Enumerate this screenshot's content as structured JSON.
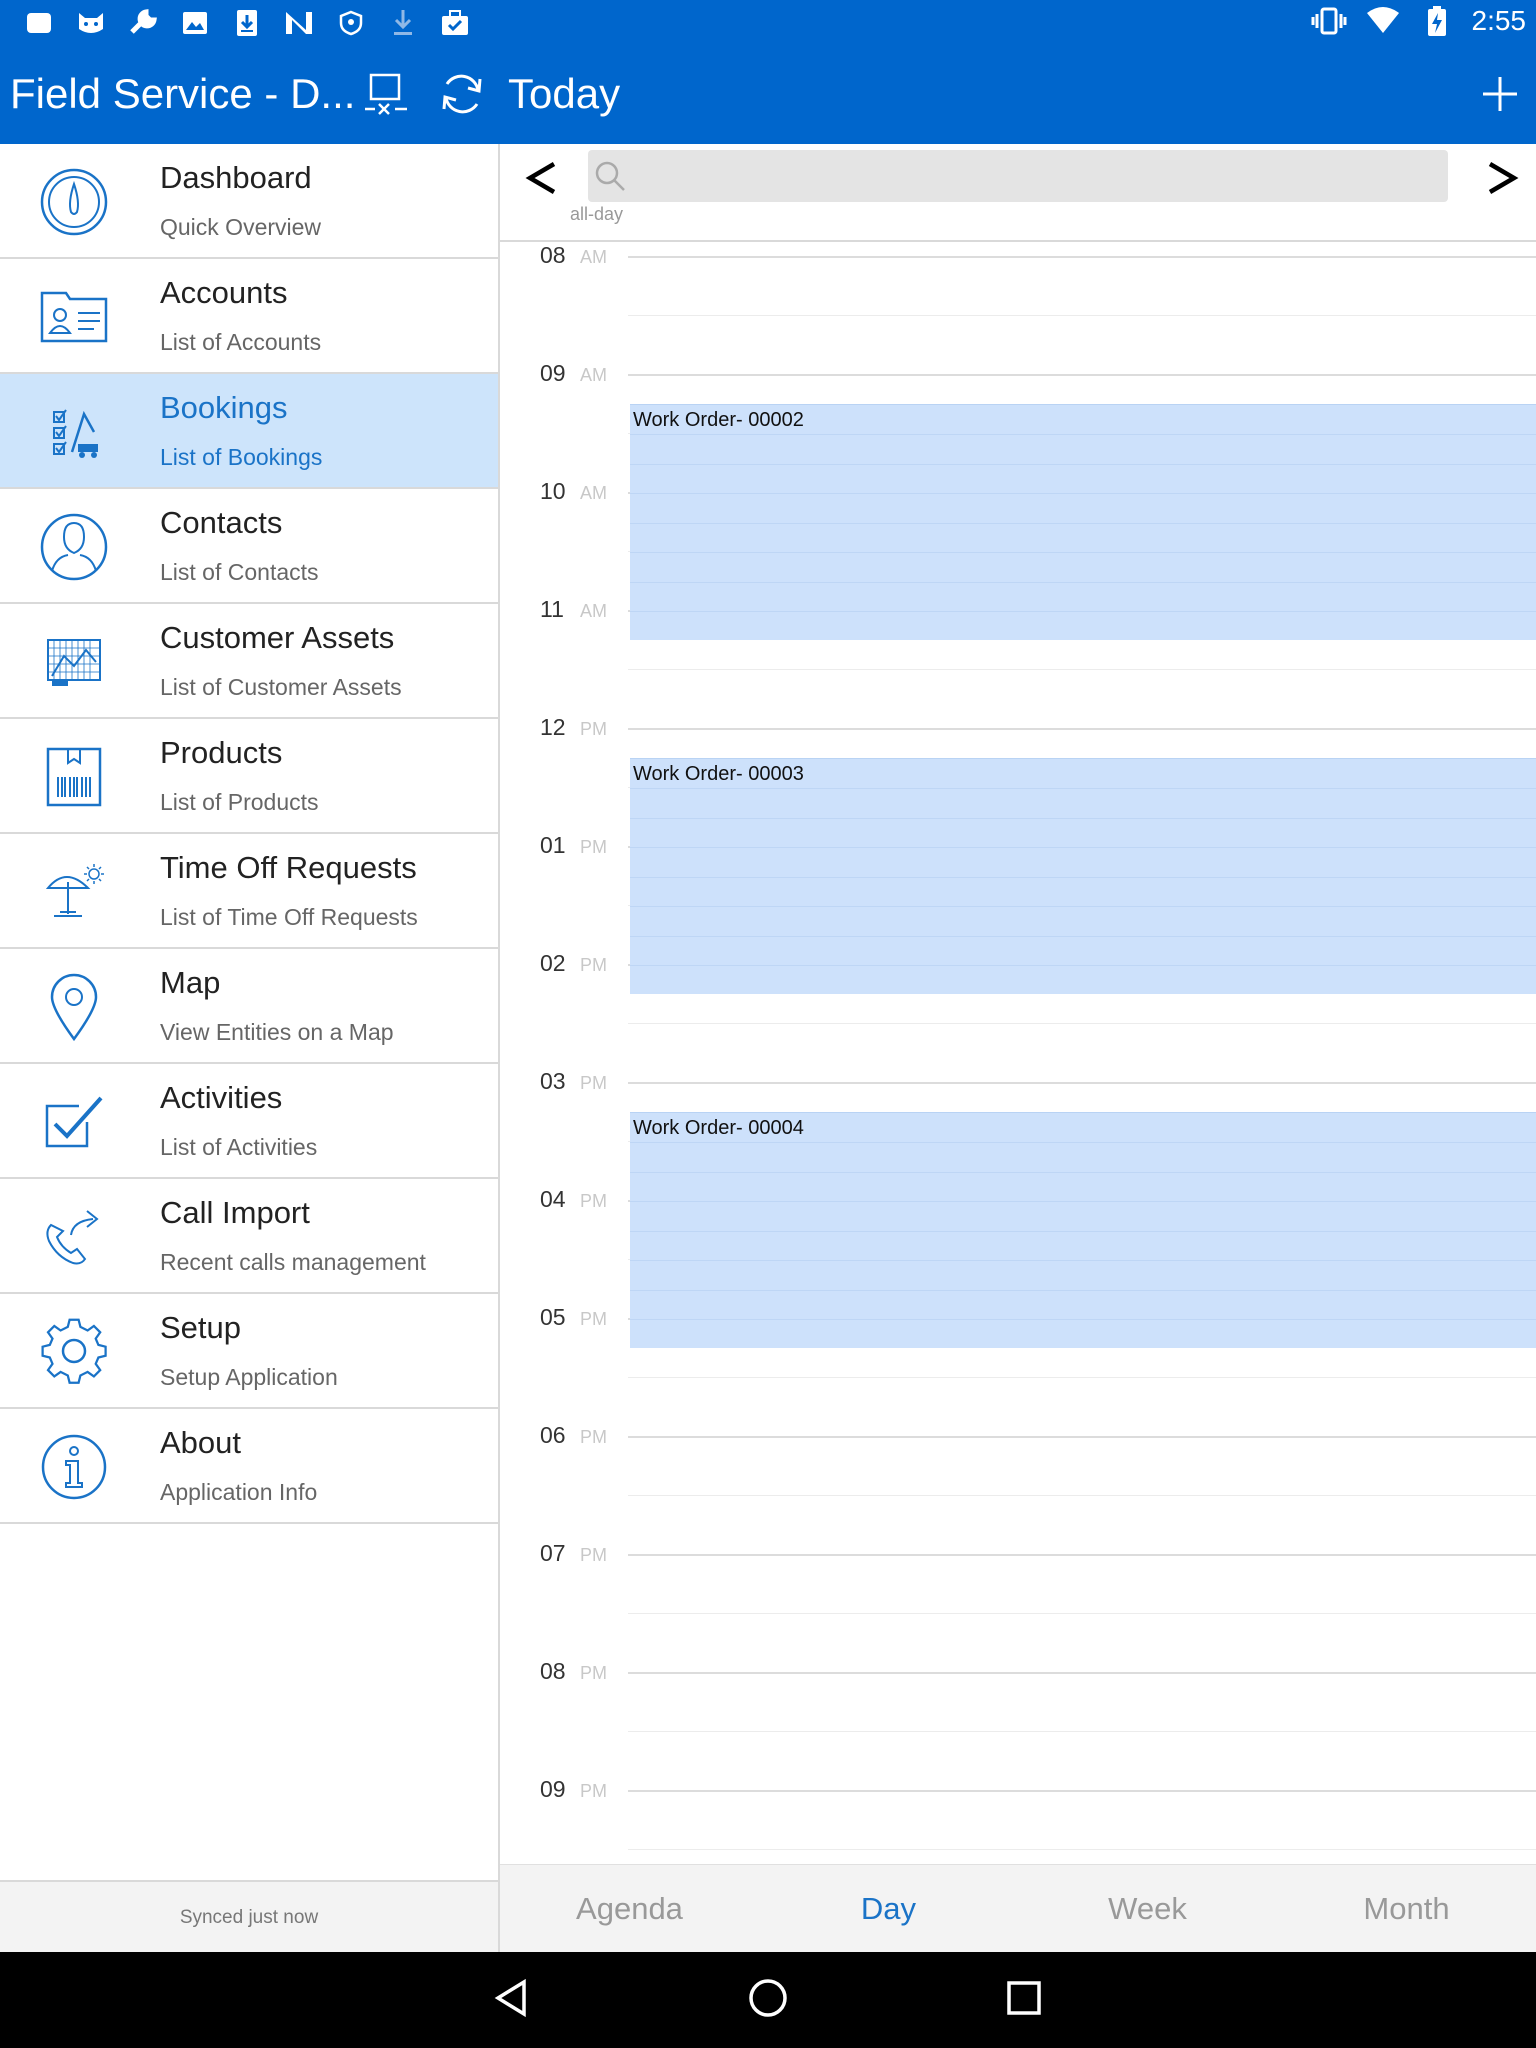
{
  "status_bar": {
    "time": "2:55",
    "left_icons": [
      "notification-icon",
      "cat-icon",
      "wrench-icon",
      "image-icon",
      "download-box-icon",
      "n-icon",
      "shield-icon",
      "download-icon",
      "briefcase-check-icon"
    ],
    "right_icons": [
      "vibrate-icon",
      "wifi-icon",
      "battery-icon"
    ]
  },
  "app_bar": {
    "title": "Field Service - D...",
    "today_label": "Today",
    "actions": [
      "disconnect-icon",
      "sync-icon",
      "add-icon"
    ]
  },
  "sidebar": {
    "items": [
      {
        "title": "Dashboard",
        "subtitle": "Quick Overview",
        "icon": "gauge-icon"
      },
      {
        "title": "Accounts",
        "subtitle": "List of Accounts",
        "icon": "contact-card-icon"
      },
      {
        "title": "Bookings",
        "subtitle": "List of Bookings",
        "icon": "checklist-crane-icon",
        "active": true
      },
      {
        "title": "Contacts",
        "subtitle": "List of Contacts",
        "icon": "person-icon"
      },
      {
        "title": "Customer Assets",
        "subtitle": "List of Customer Assets",
        "icon": "asset-icon"
      },
      {
        "title": "Products",
        "subtitle": "List of Products",
        "icon": "barcode-box-icon"
      },
      {
        "title": "Time Off Requests",
        "subtitle": "List of Time Off Requests",
        "icon": "beach-umbrella-icon"
      },
      {
        "title": "Map",
        "subtitle": "View Entities on a Map",
        "icon": "map-pin-icon"
      },
      {
        "title": "Activities",
        "subtitle": "List of Activities",
        "icon": "checkbox-icon"
      },
      {
        "title": "Call Import",
        "subtitle": "Recent calls management",
        "icon": "phone-forward-icon"
      },
      {
        "title": "Setup",
        "subtitle": "Setup Application",
        "icon": "gear-icon"
      },
      {
        "title": "About",
        "subtitle": "Application Info",
        "icon": "info-icon"
      }
    ],
    "sync_status": "Synced just now"
  },
  "calendar": {
    "all_day_label": "all-day",
    "hours": [
      {
        "hour": "08",
        "ampm": "AM"
      },
      {
        "hour": "09",
        "ampm": "AM"
      },
      {
        "hour": "10",
        "ampm": "AM"
      },
      {
        "hour": "11",
        "ampm": "AM"
      },
      {
        "hour": "12",
        "ampm": "PM"
      },
      {
        "hour": "01",
        "ampm": "PM"
      },
      {
        "hour": "02",
        "ampm": "PM"
      },
      {
        "hour": "03",
        "ampm": "PM"
      },
      {
        "hour": "04",
        "ampm": "PM"
      },
      {
        "hour": "05",
        "ampm": "PM"
      },
      {
        "hour": "06",
        "ampm": "PM"
      },
      {
        "hour": "07",
        "ampm": "PM"
      },
      {
        "hour": "08",
        "ampm": "PM"
      },
      {
        "hour": "09",
        "ampm": "PM"
      }
    ],
    "events": [
      {
        "title": "Work Order- 00002",
        "start_hour": 9.25,
        "end_hour": 11.25
      },
      {
        "title": "Work Order- 00003",
        "start_hour": 12.25,
        "end_hour": 14.25
      },
      {
        "title": "Work Order- 00004",
        "start_hour": 15.25,
        "end_hour": 17.25
      }
    ],
    "view_tabs": [
      {
        "label": "Agenda"
      },
      {
        "label": "Day",
        "active": true
      },
      {
        "label": "Week"
      },
      {
        "label": "Month"
      }
    ]
  },
  "colors": {
    "brand": "#0066cc",
    "accent": "#1a73c7",
    "active_row": "#cde4fb",
    "event_fill": "#cde1fb"
  }
}
